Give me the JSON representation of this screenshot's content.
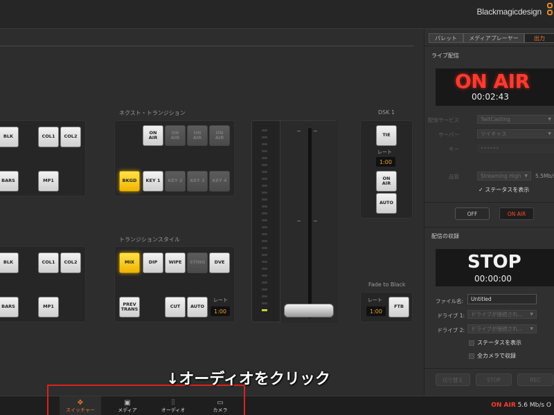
{
  "brand": "Blackmagicdesign",
  "tabs": [
    "パレット",
    "メディアプレーヤー",
    "出力"
  ],
  "main": {
    "next_transition_label": "ネクスト・トランジション",
    "transition_style_label": "トランジションスタイル",
    "dsk_label": "DSK 1",
    "ftb_label": "Fade to Black",
    "program_row": [
      "BLK",
      "COL1",
      "COL2",
      "BARS",
      "MP1"
    ],
    "preview_row": [
      "BLK",
      "COL1",
      "COL2",
      "BARS",
      "MP1"
    ],
    "next_transition": {
      "on_air_buttons": [
        "ON\nAIR",
        "ON\nAIR",
        "ON\nAIR",
        "ON\nAIR"
      ],
      "layer_buttons": [
        "BKGD",
        "KEY 1",
        "KEY 2",
        "KEY 3",
        "KEY 4"
      ]
    },
    "transition_style": {
      "buttons": [
        "MIX",
        "DIP",
        "WIPE",
        "STING",
        "DVE"
      ],
      "prev_trans": "PREV\nTRANS",
      "cut": "CUT",
      "auto": "AUTO",
      "rate_label": "レート",
      "rate_value": "1:00"
    },
    "dsk": {
      "tie": "TIE",
      "rate_label": "レート",
      "rate_value": "1:00",
      "on_air": "ON\nAIR",
      "auto": "AUTO"
    },
    "ftb": {
      "rate_label": "レート",
      "rate_value": "1:00",
      "button": "FTB"
    }
  },
  "live": {
    "title": "ライブ配信",
    "status": "ON AIR",
    "time": "00:02:43",
    "service_label": "配信サービス",
    "service_value": "TwitCasting",
    "server_label": "サーバー",
    "server_value": "ツイキャス",
    "key_label": "キー",
    "key_value": "••••••",
    "quality_label": "品質",
    "quality_value": "Streaming High",
    "bitrate": "5.5Mb/s",
    "show_status": "ステータスを表示",
    "off_button": "OFF",
    "onair_button": "ON AIR"
  },
  "record": {
    "title": "配信の収録",
    "status": "STOP",
    "time": "00:00:00",
    "filename_label": "ファイル名:",
    "filename_value": "Untitled",
    "drive1_label": "ドライブ 1:",
    "drive1_value": "ドライブが接続され...",
    "drive2_label": "ドライブ 2:",
    "drive2_value": "ドライブが接続され...",
    "show_status": "ステータスを表示",
    "record_all": "全カメラで収録",
    "switch_button": "切り替え",
    "stop_button": "STOP",
    "rec_button": "REC"
  },
  "bottom_nav": [
    {
      "label": "スイッチャー",
      "icon": "switcher-icon"
    },
    {
      "label": "メディア",
      "icon": "media-icon"
    },
    {
      "label": "オーディオ",
      "icon": "audio-icon"
    },
    {
      "label": "カメラ",
      "icon": "camera-icon"
    }
  ],
  "status_bar": {
    "onair": "ON AIR",
    "rate": "5.6 Mb/s O"
  },
  "annotation": "↓オーディオをクリック",
  "colors": {
    "accent": "#f07830",
    "onair_red": "#ff3b2f",
    "highlight_yellow": "#f0b400",
    "annotation_red": "#e0201e"
  }
}
